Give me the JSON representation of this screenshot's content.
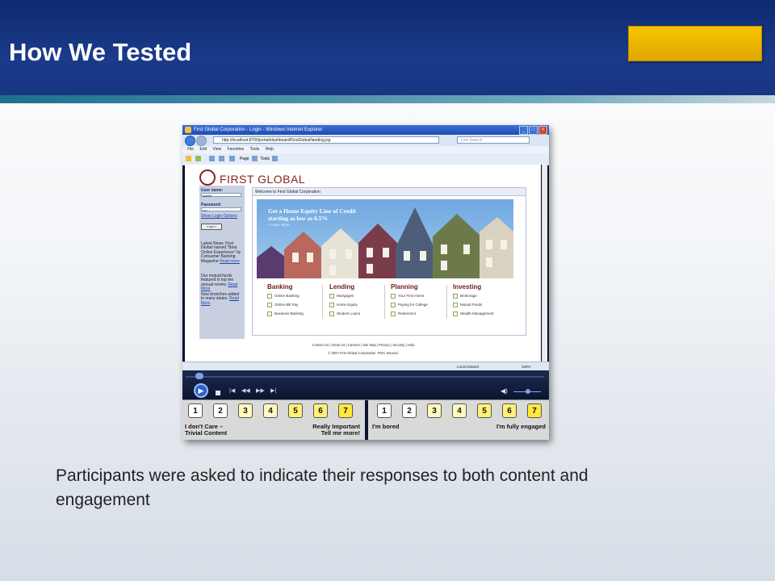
{
  "slide": {
    "title": "How We Tested",
    "caption": "Participants were asked to indicate their responses to both content and engagement"
  },
  "browser": {
    "window_title": "First Global Corporation - Login - Windows Internet Explorer",
    "address": "http://localhost:8700/portal/dashboard/FirstGlobal/landing.jsp",
    "search_placeholder": "Live Search",
    "menu": [
      "File",
      "Edit",
      "View",
      "Favorites",
      "Tools",
      "Help"
    ],
    "toolbar": {
      "page_label": "Page",
      "tools_label": "Tools"
    },
    "status": {
      "zone": "Local intranet",
      "zoom": "100%"
    }
  },
  "site": {
    "logo_text": "FIRST GLOBAL",
    "sidebar": {
      "username_label": "User name:",
      "username_value": "ssmith",
      "password_label": "Password:",
      "password_value": "••••",
      "login_options_link": "Show Login Options",
      "login_button": "Log In",
      "news_1": "Latest News: First Global named \"Best Online Experience\" by Consumer Banking Magazine",
      "news_1_link": "Read more",
      "news_2": "Our mutual funds featured in top ten annual review.",
      "news_2_link": "Read More",
      "news_3": "New branches added in many states.",
      "news_3_link": "Read More"
    },
    "welcome": "Welcome to First Global Corporation",
    "hero": {
      "headline_1": "Get a Home Equity Line of Credit",
      "headline_2": "starting as low as 6.5%",
      "link": "» Learn More"
    },
    "categories": [
      {
        "title": "Banking",
        "items": [
          "Online Banking",
          "Online Bill Pay",
          "Business Banking"
        ]
      },
      {
        "title": "Lending",
        "items": [
          "Mortgages",
          "Home Equity",
          "Student Loans"
        ]
      },
      {
        "title": "Planning",
        "items": [
          "Your First Home",
          "Paying for College",
          "Retirement"
        ]
      },
      {
        "title": "Investing",
        "items": [
          "Brokerage",
          "Mutual Funds",
          "Wealth Management"
        ]
      }
    ],
    "footer_links": "Contact Us  |  About Us  |  Careers  |  Site Map  |  Privacy  |  Security  |  Help",
    "footer_copy": "© 2007 First Global Corporation. FDIC Insured."
  },
  "rating": {
    "content": {
      "buttons": [
        "1",
        "2",
        "3",
        "4",
        "5",
        "6",
        "7"
      ],
      "low_label": "I don't Care –",
      "low_label_2": "Trivial Content",
      "high_label": "Really Important",
      "high_label_2": "Tell me more!"
    },
    "engagement": {
      "buttons": [
        "1",
        "2",
        "3",
        "4",
        "5",
        "6",
        "7"
      ],
      "low_label": "I'm bored",
      "high_label": "I'm fully engaged"
    }
  },
  "colors": {
    "header_blue": "#1a3a8a",
    "gold": "#f0b800",
    "brand_red": "#8a2520"
  }
}
